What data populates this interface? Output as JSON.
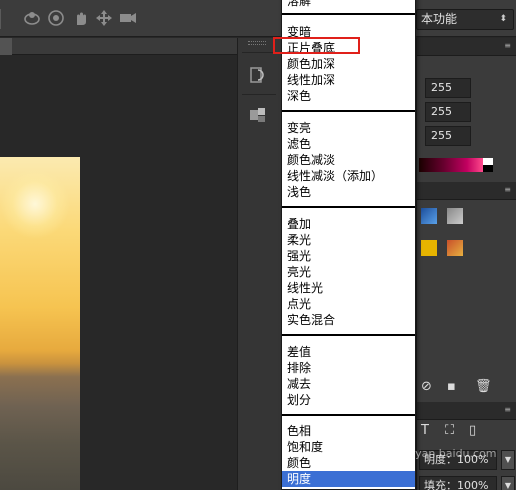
{
  "workspace": {
    "label": "本功能",
    "arrow": "⬍"
  },
  "toolbar_icons": [
    "3d-rotate-icon",
    "3d-roll-icon",
    "3d-pan-icon",
    "3d-slide-icon",
    "3d-scale-video-icon"
  ],
  "color_panel": {
    "values": [
      "255",
      "255",
      "255"
    ]
  },
  "layers_panel": {
    "opacity_label": "明度：",
    "opacity_value": "100%",
    "fill_label": "填充：",
    "fill_value": "100%"
  },
  "blend_menu": {
    "partial_top_label": "溶解",
    "groups": [
      [
        "变暗",
        "正片叠底",
        "颜色加深",
        "线性加深",
        "深色"
      ],
      [
        "变亮",
        "滤色",
        "颜色减淡",
        "线性减淡（添加）",
        "浅色"
      ],
      [
        "叠加",
        "柔光",
        "强光",
        "亮光",
        "线性光",
        "点光",
        "实色混合"
      ],
      [
        "差值",
        "排除",
        "减去",
        "划分"
      ],
      [
        "色相",
        "饱和度",
        "颜色",
        "明度"
      ]
    ],
    "highlighted_item": "正片叠底",
    "selected_item": "明度"
  },
  "watermark": "jingyan.baidu.com",
  "colors": {
    "menu_selection": "#3b6fd4",
    "highlight_box": "#e0201a",
    "ui_dark": "#282828"
  }
}
